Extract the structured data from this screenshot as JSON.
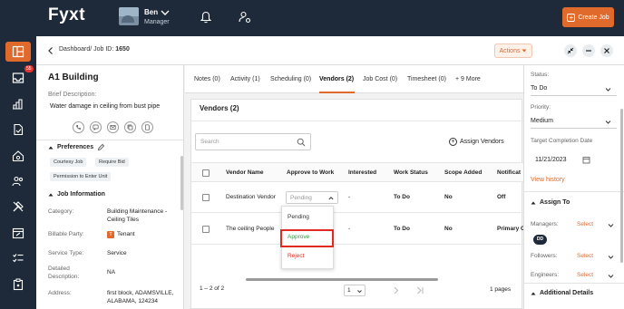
{
  "app": {
    "logo": "Fyxt"
  },
  "user": {
    "name": "Ben",
    "role": "Manager"
  },
  "topbar": {
    "create_job_label": "Create Job"
  },
  "sidebar": {
    "inbox_badge": "55"
  },
  "header": {
    "breadcrumb_prefix": "Dashboard/ Job ID:",
    "job_id": "1650",
    "actions_label": "Actions"
  },
  "job": {
    "title": "A1 Building",
    "brief_label": "Brief Description:",
    "brief": "Water damage in ceiling from bust pipe",
    "preferences_label": "Preferences",
    "preferences": [
      "Courtesy Job",
      "Require Bid",
      "Permission to Enter Unit"
    ],
    "info_label": "Job Information",
    "fields": [
      {
        "label": "Category:",
        "value": "Building Maintenance - Ceiling Tiles"
      },
      {
        "label": "Billable Party:",
        "value": "Tenant"
      },
      {
        "label": "Service Type:",
        "value": "Service"
      },
      {
        "label": "Detailed Description:",
        "value": "NA"
      },
      {
        "label": "Address:",
        "value": "first block, ADAMSVILLE, ALABAMA, 124234"
      }
    ]
  },
  "tabs": [
    {
      "label": "Notes (0)"
    },
    {
      "label": "Activity (1)"
    },
    {
      "label": "Scheduling (0)"
    },
    {
      "label": "Vendors (2)"
    },
    {
      "label": "Job Cost (0)"
    },
    {
      "label": "Timesheet (0)"
    },
    {
      "label": "+ 9 More"
    }
  ],
  "vendors": {
    "title": "Vendors (2)",
    "search_placeholder": "Search",
    "assign_label": "Assign Vendors",
    "columns": [
      "Vendor Name",
      "Approve to Work",
      "Interested",
      "Work Status",
      "Scope Added",
      "Notificat"
    ],
    "rows": [
      {
        "name": "Destination Vendor",
        "approve": "Pending",
        "interested": "-",
        "status": "To Do",
        "scope": "No",
        "notification": "Off"
      },
      {
        "name": "The ceiling People",
        "approve": "",
        "interested": "-",
        "status": "To Do",
        "scope": "No",
        "notification": "Primary C"
      }
    ],
    "dropdown_options": [
      "Pending",
      "Approve",
      "Reject"
    ],
    "range": "1 – 2 of 2",
    "page": "1",
    "pages": "1 pages"
  },
  "right": {
    "status_label": "Status:",
    "status_value": "To Do",
    "priority_label": "Priority:",
    "priority_value": "Medium",
    "target_label": "Target Completion Date",
    "target_value": "11/21/2023",
    "view_history": "View history",
    "assign_to_label": "Assign To",
    "managers_label": "Managers:",
    "followers_label": "Followers:",
    "engineers_label": "Engineers:",
    "select_label": "Select",
    "manager_initials": "DD",
    "additional_details_label": "Additional Details"
  },
  "colors": {
    "accent": "#e06a2b",
    "navy": "#1e2a3a",
    "highlight": "#e02b20",
    "approve": "#2e9e3e"
  }
}
